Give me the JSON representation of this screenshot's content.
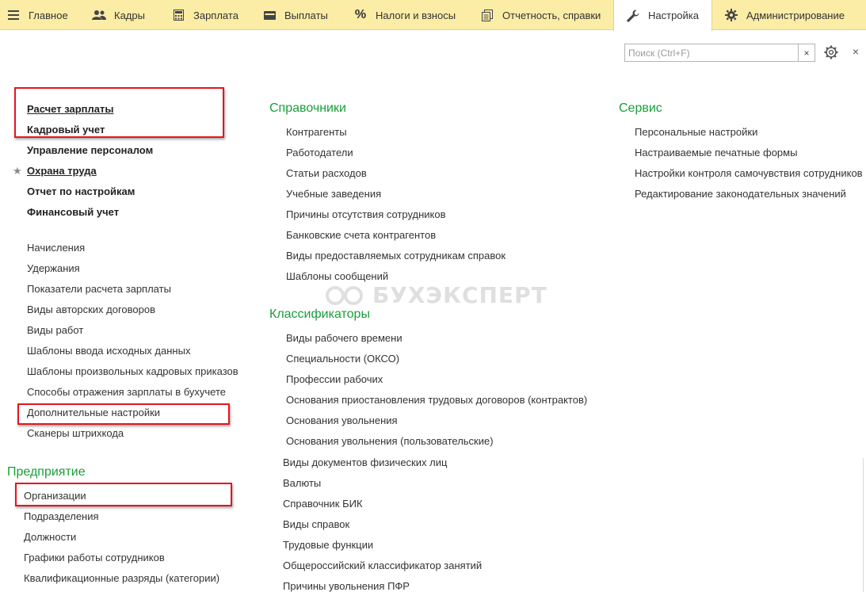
{
  "topbar": {
    "tabs": [
      {
        "label": "Главное",
        "icon": "menu-icon"
      },
      {
        "label": "Кадры",
        "icon": "people-icon"
      },
      {
        "label": "Зарплата",
        "icon": "calculator-icon"
      },
      {
        "label": "Выплаты",
        "icon": "wallet-icon"
      },
      {
        "label": "Налоги и взносы",
        "icon": "percent-icon"
      },
      {
        "label": "Отчетность, справки",
        "icon": "documents-icon"
      },
      {
        "label": "Настройка",
        "icon": "wrench-icon",
        "active": true
      },
      {
        "label": "Администрирование",
        "icon": "gear-icon"
      }
    ]
  },
  "search": {
    "placeholder": "Поиск (Ctrl+F)",
    "clear": "×",
    "close": "×"
  },
  "left": {
    "bold_items": [
      "Расчет зарплаты",
      "Кадровый учет",
      "Управление персоналом",
      "Охрана труда",
      "Отчет по настройкам",
      "Финансовый учет"
    ],
    "items": [
      "Начисления",
      "Удержания",
      "Показатели расчета зарплаты",
      "Виды авторских договоров",
      "Виды работ",
      "Шаблоны ввода исходных данных",
      "Шаблоны произвольных кадровых приказов",
      "Способы отражения зарплаты в бухучете",
      "Дополнительные настройки",
      "Сканеры штрихкода"
    ],
    "enterprise_title": "Предприятие",
    "enterprise_items": [
      "Организации",
      "Подразделения",
      "Должности",
      "Графики работы сотрудников",
      "Квалификационные разряды (категории)"
    ]
  },
  "middle": {
    "ref_title": "Справочники",
    "ref_items": [
      "Контрагенты",
      "Работодатели",
      "Статьи расходов",
      "Учебные заведения",
      "Причины отсутствия сотрудников",
      "Банковские счета контрагентов",
      "Виды предоставляемых сотрудникам справок",
      "Шаблоны сообщений"
    ],
    "cls_title": "Классификаторы",
    "cls_items": [
      "Виды рабочего времени",
      "Специальности (ОКСО)",
      "Профессии рабочих",
      "Основания приостановления трудовых договоров (контрактов)",
      "Основания увольнения",
      "Основания увольнения (пользовательские)"
    ],
    "other_items": [
      "Виды документов физических лиц",
      "Валюты",
      "Справочник БИК",
      "Виды справок",
      "Трудовые функции",
      "Общероссийский классификатор занятий",
      "Причины увольнения ПФР"
    ]
  },
  "right": {
    "title": "Сервис",
    "items": [
      "Персональные настройки",
      "Настраиваемые печатные формы",
      "Настройки контроля самочувствия сотрудников",
      "Редактирование законодательных значений"
    ]
  },
  "watermark": "БУХЭКСПЕРТ",
  "colors": {
    "menu_bg": "#fbeca6",
    "section_head": "#1a9e3a",
    "highlight": "#e8141d"
  }
}
